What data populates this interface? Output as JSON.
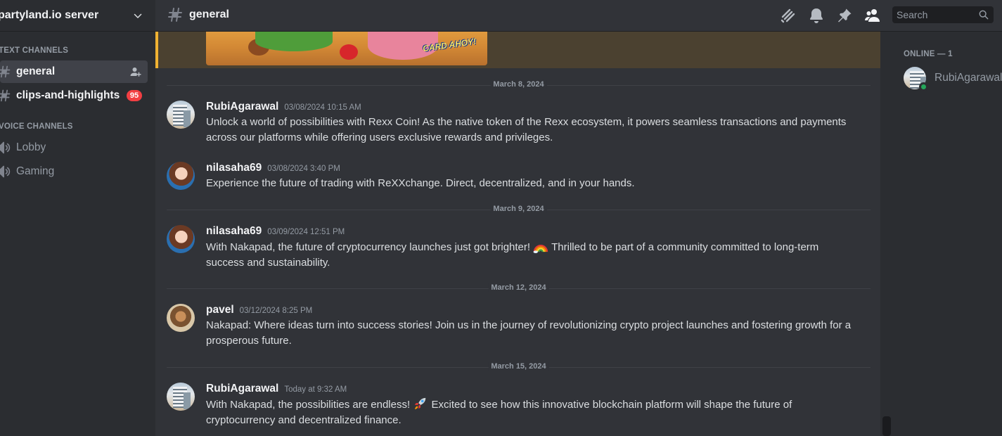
{
  "server": {
    "name": "partyland.io server"
  },
  "sidebar": {
    "text_category": "TEXT CHANNELS",
    "voice_category": "VOICE CHANNELS",
    "text_channels": [
      {
        "label": "general",
        "active": true
      },
      {
        "label": "clips-and-highlights",
        "badge": "95"
      }
    ],
    "voice_channels": [
      {
        "label": "Lobby"
      },
      {
        "label": "Gaming"
      }
    ]
  },
  "header": {
    "channel": "general",
    "search_placeholder": "Search"
  },
  "embed": {
    "logo_text": "CARD AHOY!"
  },
  "chat": {
    "dividers": [
      "March 8, 2024",
      "March 9, 2024",
      "March 12, 2024",
      "March 15, 2024"
    ],
    "messages": [
      {
        "author": "RubiAgarawal",
        "timestamp": "03/08/2024 10:15 AM",
        "text": "Unlock a world of possibilities with Rexx Coin! As the native token of the Rexx ecosystem, it powers seamless transactions and payments across our platforms while offering users exclusive rewards and privileges."
      },
      {
        "author": "nilasaha69",
        "timestamp": "03/08/2024 3:40 PM",
        "text": "Experience the future of trading with ReXXchange. Direct, decentralized, and in your hands."
      },
      {
        "author": "nilasaha69",
        "timestamp": "03/09/2024 12:51 PM",
        "text_before": "With Nakapad, the future of cryptocurrency launches just got brighter! ",
        "emoji": "rainbow-emoji",
        "text_after": " Thrilled to be part of a community committed to long-term success and sustainability."
      },
      {
        "author": "pavel",
        "timestamp": "03/12/2024 8:25 PM",
        "text": "Nakapad: Where ideas turn into success stories! Join us in the journey of revolutionizing crypto project launches and fostering growth for a prosperous future."
      },
      {
        "author": "RubiAgarawal",
        "timestamp": "Today at 9:32 AM",
        "text_before": "With Nakapad, the possibilities are endless! ",
        "emoji": "rocket-emoji",
        "text_after": " Excited to see how this innovative blockchain platform will shape the future of cryptocurrency and decentralized finance."
      }
    ]
  },
  "members": {
    "online_label": "ONLINE — 1",
    "list": [
      {
        "name": "RubiAgarawal",
        "status": "online"
      }
    ]
  },
  "colors": {
    "accent_unread": "#f23f43",
    "online": "#23a55a",
    "embed_border": "#f0b232"
  }
}
